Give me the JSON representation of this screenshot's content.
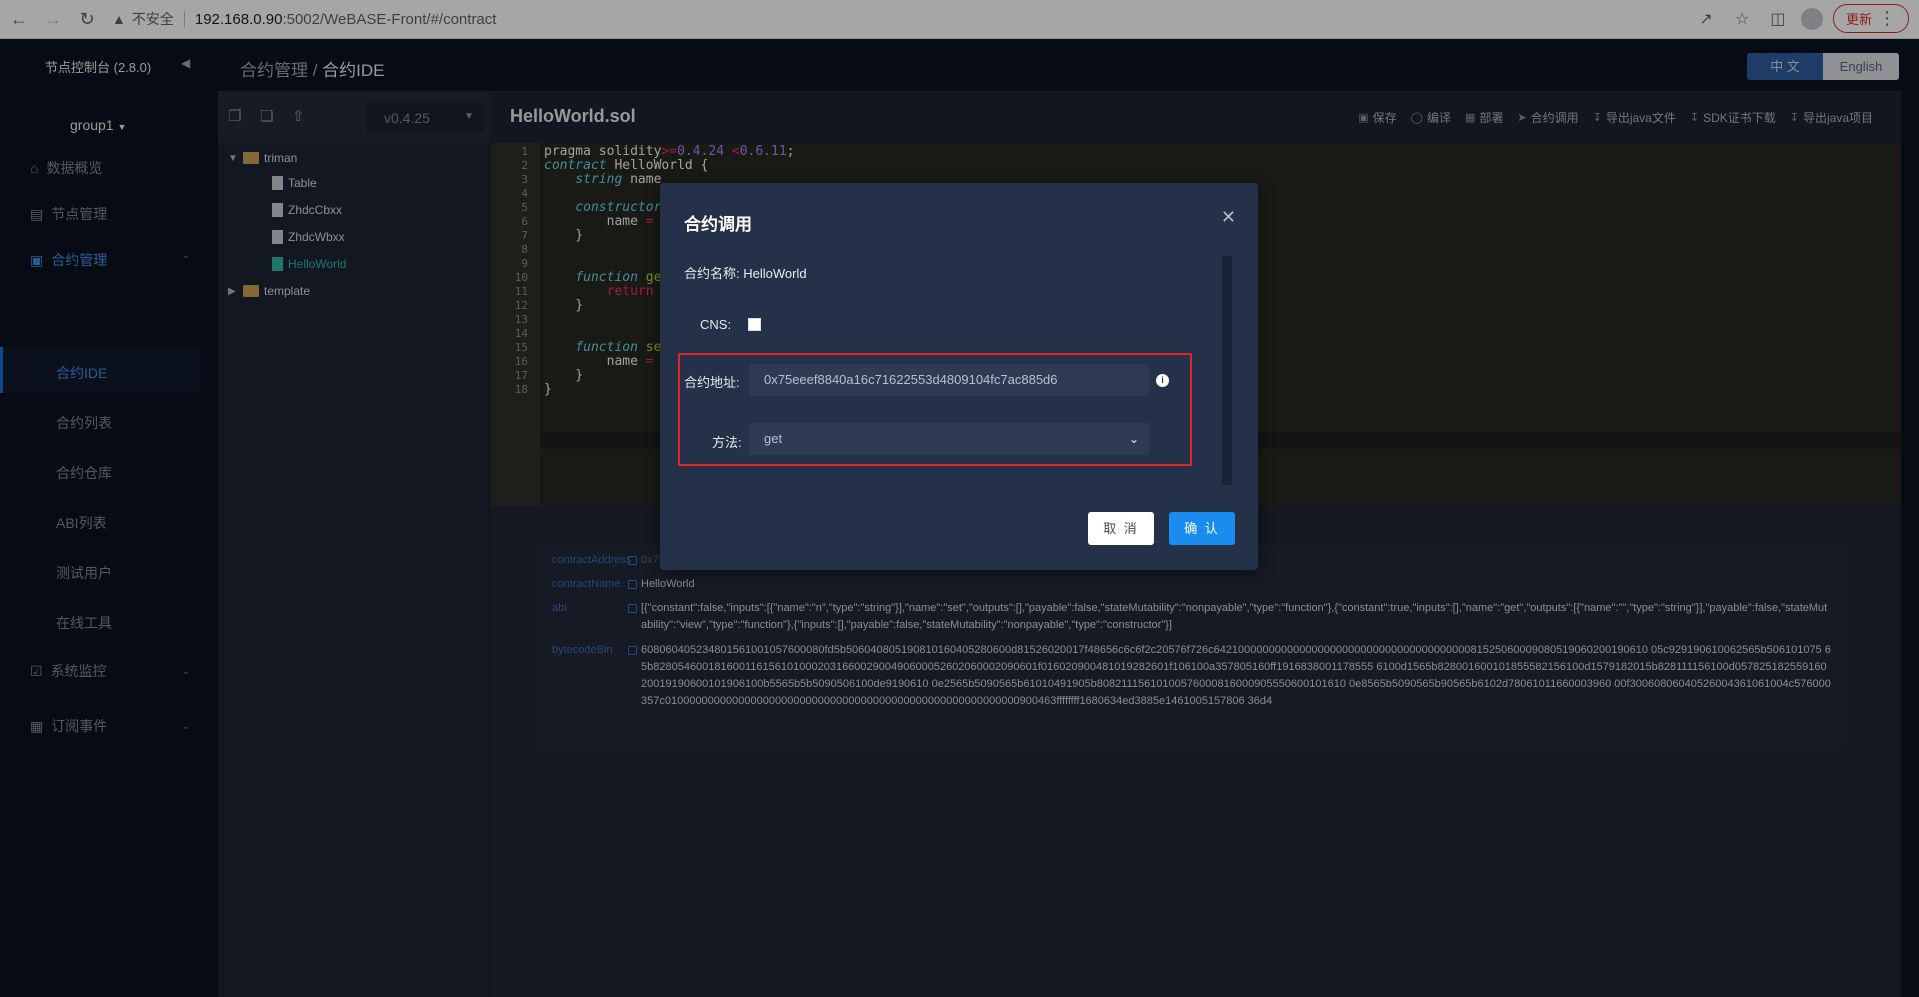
{
  "browser": {
    "insecure_label": "不安全",
    "url_host": "192.168.0.90",
    "url_path": ":5002/WeBASE-Front/#/contract",
    "update_label": "更新"
  },
  "sidebar": {
    "title": "节点控制台 (2.8.0)",
    "group": "group1",
    "items": [
      {
        "label": "数据概览",
        "icon": "home-icon"
      },
      {
        "label": "节点管理",
        "icon": "calendar-icon"
      },
      {
        "label": "合约管理",
        "icon": "clipboard-icon"
      },
      {
        "label": "系统监控",
        "icon": "shield-check-icon"
      },
      {
        "label": "订阅事件",
        "icon": "rss-icon"
      }
    ],
    "contract_subitems": [
      "合约IDE",
      "合约列表",
      "合约仓库",
      "ABI列表",
      "测试用户",
      "在线工具"
    ]
  },
  "header": {
    "breadcrumb_parent": "合约管理",
    "breadcrumb_sep": " / ",
    "breadcrumb_current": "合约IDE",
    "lang_zh": "中 文",
    "lang_en": "English"
  },
  "filepanel": {
    "version": "v0.4.25",
    "tree": [
      {
        "label": "triman",
        "type": "folder",
        "expanded": true
      },
      {
        "label": "Table",
        "type": "file"
      },
      {
        "label": "ZhdcCbxx",
        "type": "file"
      },
      {
        "label": "ZhdcWbxx",
        "type": "file"
      },
      {
        "label": "HelloWorld",
        "type": "file",
        "active": true
      },
      {
        "label": "template",
        "type": "folder",
        "expanded": false
      }
    ]
  },
  "editor": {
    "filename": "HelloWorld.sol",
    "actions": [
      "保存",
      "编译",
      "部署",
      "合约调用",
      "导出java文件",
      "SDK证书下载",
      "导出java项目"
    ],
    "line_numbers": [
      "1",
      "2",
      "3",
      "4",
      "5",
      "6",
      "7",
      "8",
      "9",
      "10",
      "11",
      "12",
      "13",
      "14",
      "15",
      "16",
      "17",
      "18"
    ]
  },
  "result": {
    "rows": [
      {
        "key": "contractAddress",
        "value": "0x75eeef8840a16c71622553d4809104fc7ac885d6"
      },
      {
        "key": "contractName",
        "value": "HelloWorld"
      },
      {
        "key": "abi",
        "value": "[{\"constant\":false,\"inputs\":[{\"name\":\"n\",\"type\":\"string\"}],\"name\":\"set\",\"outputs\":[],\"payable\":false,\"stateMutability\":\"nonpayable\",\"type\":\"function\"},{\"constant\":true,\"inputs\":[],\"name\":\"get\",\"outputs\":[{\"name\":\"\",\"type\":\"string\"}],\"payable\":false,\"stateMutability\":\"view\",\"type\":\"function\"},{\"inputs\":[],\"payable\":false,\"stateMutability\":\"nonpayable\",\"type\":\"constructor\"}]"
      },
      {
        "key": "bytecodeBin",
        "value": "608060405234801561001057600080fd5b506040805190810160405280600d81526020017f48656c6c6f2c20576f726c64210000000000000000000000000000000000000081525060009080519060200190610 05c929190610062565b506101075 65b828054600181600116156101000203166002900490600052602060002090601f016020900481019282601f106100a357805160ff1916838001178555 6100d1565b828001600101855582156100d1579182015b828111156100d05782518255916020019190600101906100b5565b5b5090506100de9190610 0e2565b5090565b61010491905b80821115610100576000816000905550600101610 0e8565b5090565b90565b6102d78061011660003960 00f30060806040526004361061004c576000357c0100000000000000000000000000000000000000000000000000000000900463ffffffff1680634ed3885e1461005157806 36d4"
      }
    ]
  },
  "dialog": {
    "title": "合约调用",
    "name_label": "合约名称:",
    "name_value": "HelloWorld",
    "cns_label": "CNS:",
    "address_label": "合约地址:",
    "address_value": "0x75eeef8840a16c71622553d4809104fc7ac885d6",
    "method_label": "方法:",
    "method_value": "get",
    "cancel_label": "取 消",
    "confirm_label": "确 认"
  }
}
